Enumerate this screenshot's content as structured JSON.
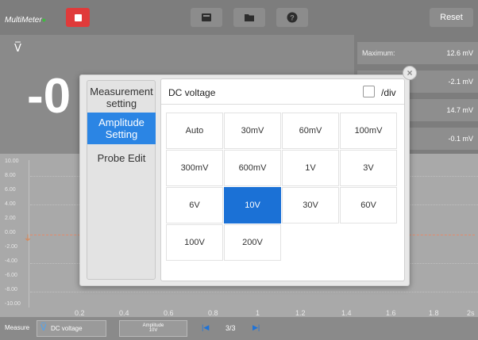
{
  "app": {
    "title": "MultiMeter",
    "reset_label": "Reset"
  },
  "toolbar_icons": [
    "record-icon",
    "folder-icon",
    "help-icon"
  ],
  "reading": {
    "mode_symbol": "V̅",
    "value": "-0"
  },
  "stats": [
    {
      "label": "Maximum:",
      "value": "12.6 mV"
    },
    {
      "label": "",
      "value": "-2.1 mV"
    },
    {
      "label": "",
      "value": "14.7 mV"
    },
    {
      "label": "",
      "value": "-0.1 mV"
    }
  ],
  "graph": {
    "y_ticks": [
      "10.00",
      "8.00",
      "6.00",
      "4.00",
      "2.00",
      "0.00",
      "-2.00",
      "-4.00",
      "-6.00",
      "-8.00",
      "-10.00"
    ],
    "x_ticks": [
      "0.2",
      "0.4",
      "0.6",
      "0.8",
      "1",
      "1.2",
      "1.4",
      "1.6",
      "1.8",
      "2s"
    ]
  },
  "bottom": {
    "measure_label": "Measure",
    "mode_symbol": "V̅",
    "mode_value": "DC voltage",
    "amplitude_label": "Amplitude",
    "amplitude_value": "10V",
    "page": "3/3"
  },
  "modal": {
    "tabs": [
      {
        "label_line1": "Measurement",
        "label_line2": "setting",
        "active": false
      },
      {
        "label_line1": "Amplitude",
        "label_line2": "Setting",
        "active": true
      },
      {
        "label_line1": "Probe Edit",
        "label_line2": "",
        "active": false
      }
    ],
    "panel_title": "DC voltage",
    "div_label": "/div",
    "div_checked": false,
    "options": [
      "Auto",
      "30mV",
      "60mV",
      "100mV",
      "300mV",
      "600mV",
      "1V",
      "3V",
      "6V",
      "10V",
      "30V",
      "60V",
      "100V",
      "200V"
    ],
    "selected_option": "10V"
  },
  "colors": {
    "accent": "#1b71d6",
    "stop": "#e03a3a",
    "trace": "#e48a6a"
  }
}
